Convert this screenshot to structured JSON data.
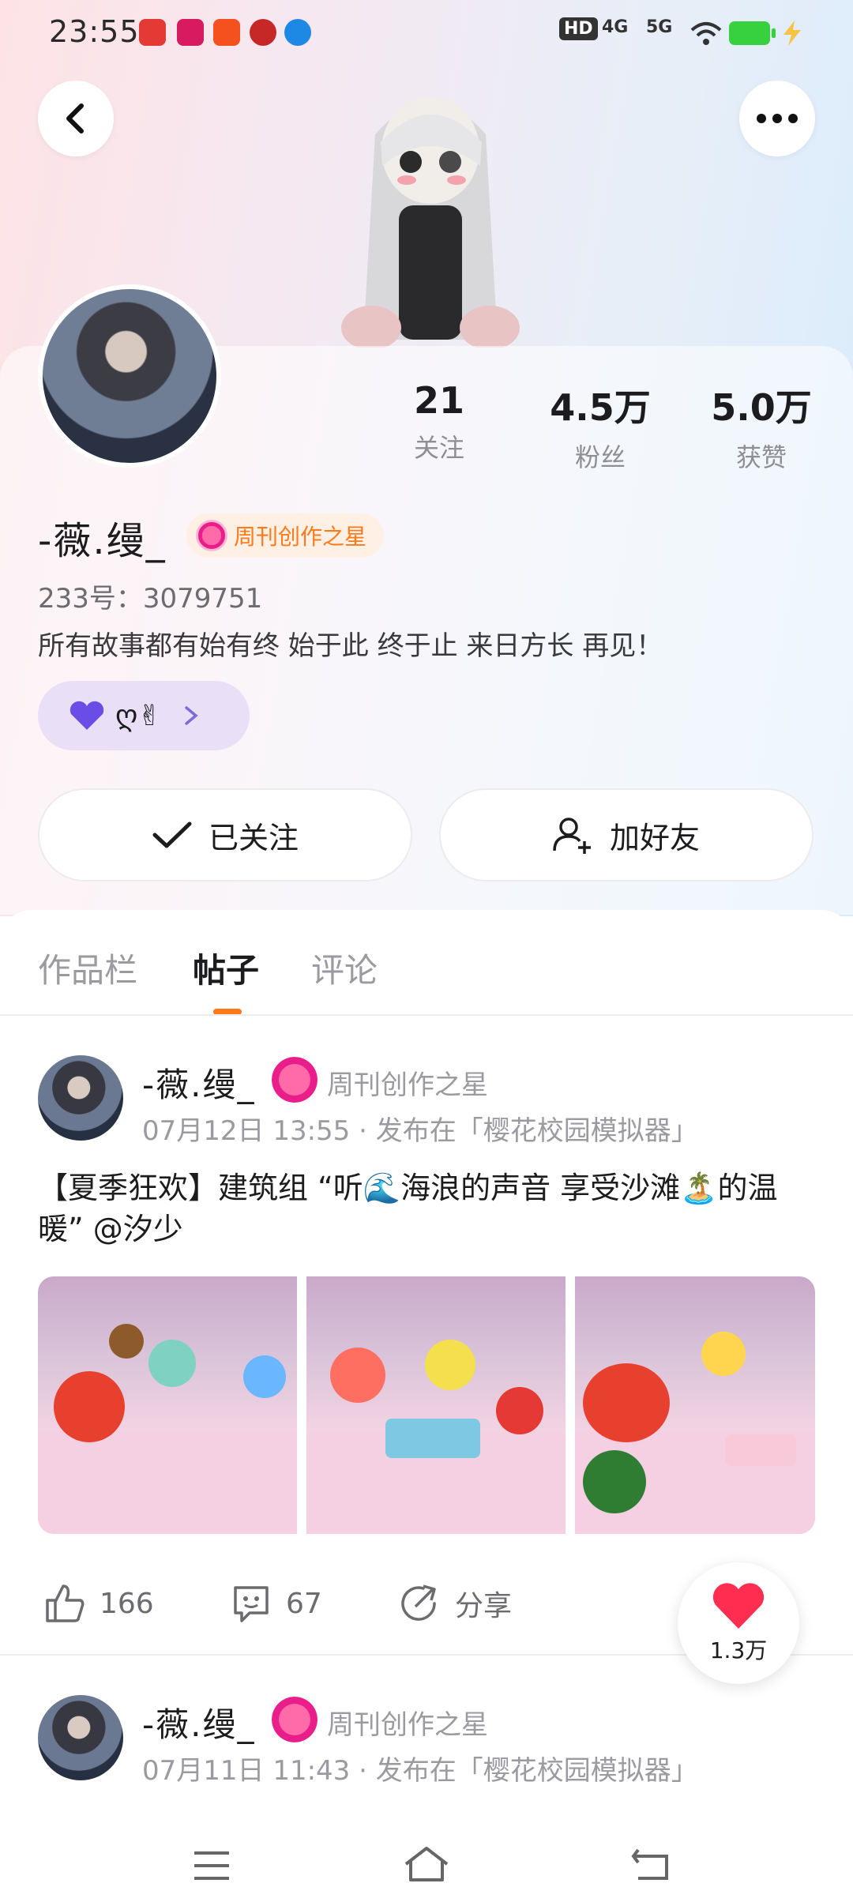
{
  "status": {
    "time": "23:55",
    "net1": "4G",
    "net2": "5G",
    "hd": "HD"
  },
  "profile": {
    "username": "-薇.缦_",
    "badge_label": "周刊创作之星",
    "uid": "233号：3079751",
    "bio": "所有故事都有始有终 始于此 终于止 来日方长 再见！",
    "tag_text": "ღ✌"
  },
  "stats": [
    {
      "num": "21",
      "label": "关注"
    },
    {
      "num": "4.5万",
      "label": "粉丝"
    },
    {
      "num": "5.0万",
      "label": "获赞"
    }
  ],
  "buttons": {
    "followed": "已关注",
    "add_friend": "加好友"
  },
  "tabs": [
    "作品栏",
    "帖子",
    "评论"
  ],
  "posts": [
    {
      "name": "-薇.缦_",
      "badge": "周刊创作之星",
      "meta": "07月12日 13:55 · 发布在「樱花校园模拟器」",
      "text": "【夏季狂欢】建筑组 “听🌊海浪的声音 享受沙滩🏝️的温暖” @汐少",
      "likes": "166",
      "comments": "67",
      "share": "分享"
    },
    {
      "name": "-薇.缦_",
      "badge": "周刊创作之星",
      "meta": "07月11日 11:43 · 发布在「樱花校园模拟器」"
    }
  ],
  "fab": {
    "count": "1.3万"
  },
  "colors": {
    "accent": "#ff7a1a",
    "heart": "#ff2d4f",
    "pill": "#e9e0f8"
  }
}
